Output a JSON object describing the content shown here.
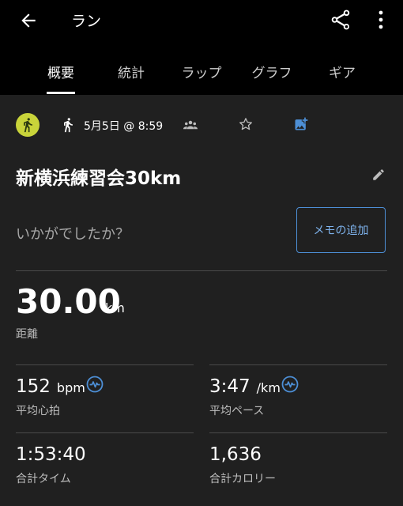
{
  "header": {
    "title": "ラン"
  },
  "tabs": [
    {
      "label": "概要",
      "active": true
    },
    {
      "label": "統計"
    },
    {
      "label": "ラップ"
    },
    {
      "label": "グラフ"
    },
    {
      "label": "ギア"
    }
  ],
  "activity": {
    "date": "5月5日 @ 8:59",
    "name": "新横浜練習会30km",
    "question": "いかがでしたか？",
    "memo_button": "メモの追加"
  },
  "stats": {
    "distance": {
      "value": "30.00",
      "unit": "km",
      "label": "距離"
    },
    "heart_rate": {
      "value": "152",
      "unit": "bpm",
      "label": "平均心拍"
    },
    "pace": {
      "value": "3:47",
      "unit": "/km",
      "label": "平均ペース"
    },
    "time": {
      "value": "1:53:40",
      "label": "合計タイム"
    },
    "calories": {
      "value": "1,636",
      "label": "合計カロリー"
    }
  },
  "colors": {
    "accent": "#4d8fd6",
    "avatar": "#c9d43a",
    "background": "#202020"
  },
  "icons": [
    "back-arrow-icon",
    "share-icon",
    "more-vert-icon",
    "running-person-icon",
    "group-icon",
    "star-icon",
    "add-photo-icon",
    "pencil-icon",
    "heart-rate-icon"
  ]
}
